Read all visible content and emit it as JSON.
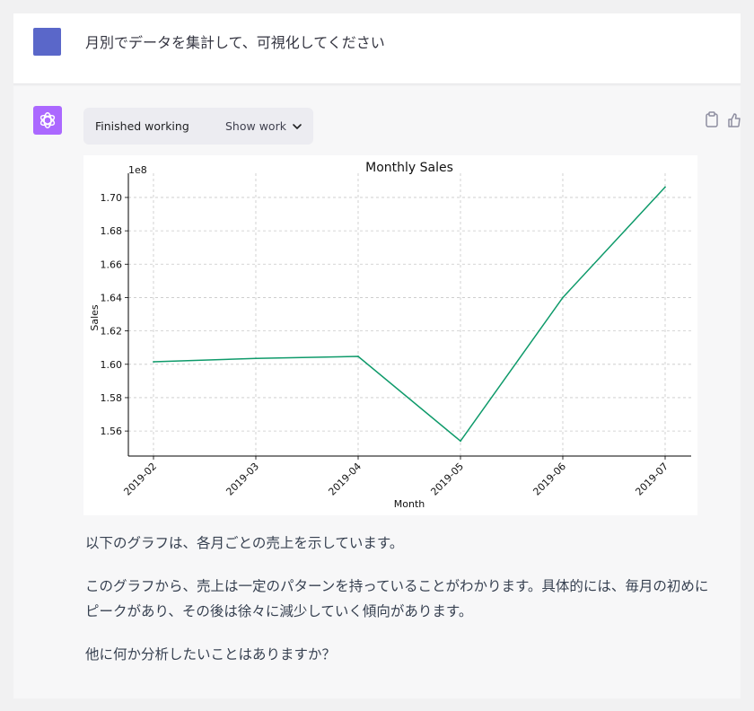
{
  "user": {
    "avatar_color": "#5a67c9",
    "message": "月別でデータを集計して、可視化してください"
  },
  "assistant": {
    "avatar_color": "#ab68ff",
    "avatar_icon": "openai-logo-icon",
    "work_status": "Finished working",
    "show_work_label": "Show work",
    "actions": [
      "clipboard-icon",
      "thumbs-up-icon"
    ],
    "paragraphs": [
      "以下のグラフは、各月ごとの売上を示しています。",
      "このグラフから、売上は一定のパターンを持っていることがわかります。具体的には、毎月の初めにピークがあり、その後は徐々に減少していく傾向があります。",
      "他に何か分析したいことはありますか？"
    ]
  },
  "chart_data": {
    "type": "line",
    "title": "Monthly Sales",
    "xlabel": "Month",
    "ylabel": "Sales",
    "y_offset_label": "1e8",
    "x": [
      "2019-02",
      "2019-03",
      "2019-04",
      "2019-05",
      "2019-06",
      "2019-07"
    ],
    "series": [
      {
        "values": [
          1.6015,
          1.6035,
          1.6047,
          1.554,
          1.64,
          1.7062
        ],
        "color": "#0e9a6a"
      }
    ],
    "ylim": [
      1.545,
      1.7145
    ],
    "yticks": [
      "1.56",
      "1.58",
      "1.60",
      "1.62",
      "1.64",
      "1.66",
      "1.68",
      "1.70"
    ],
    "grid": true
  }
}
